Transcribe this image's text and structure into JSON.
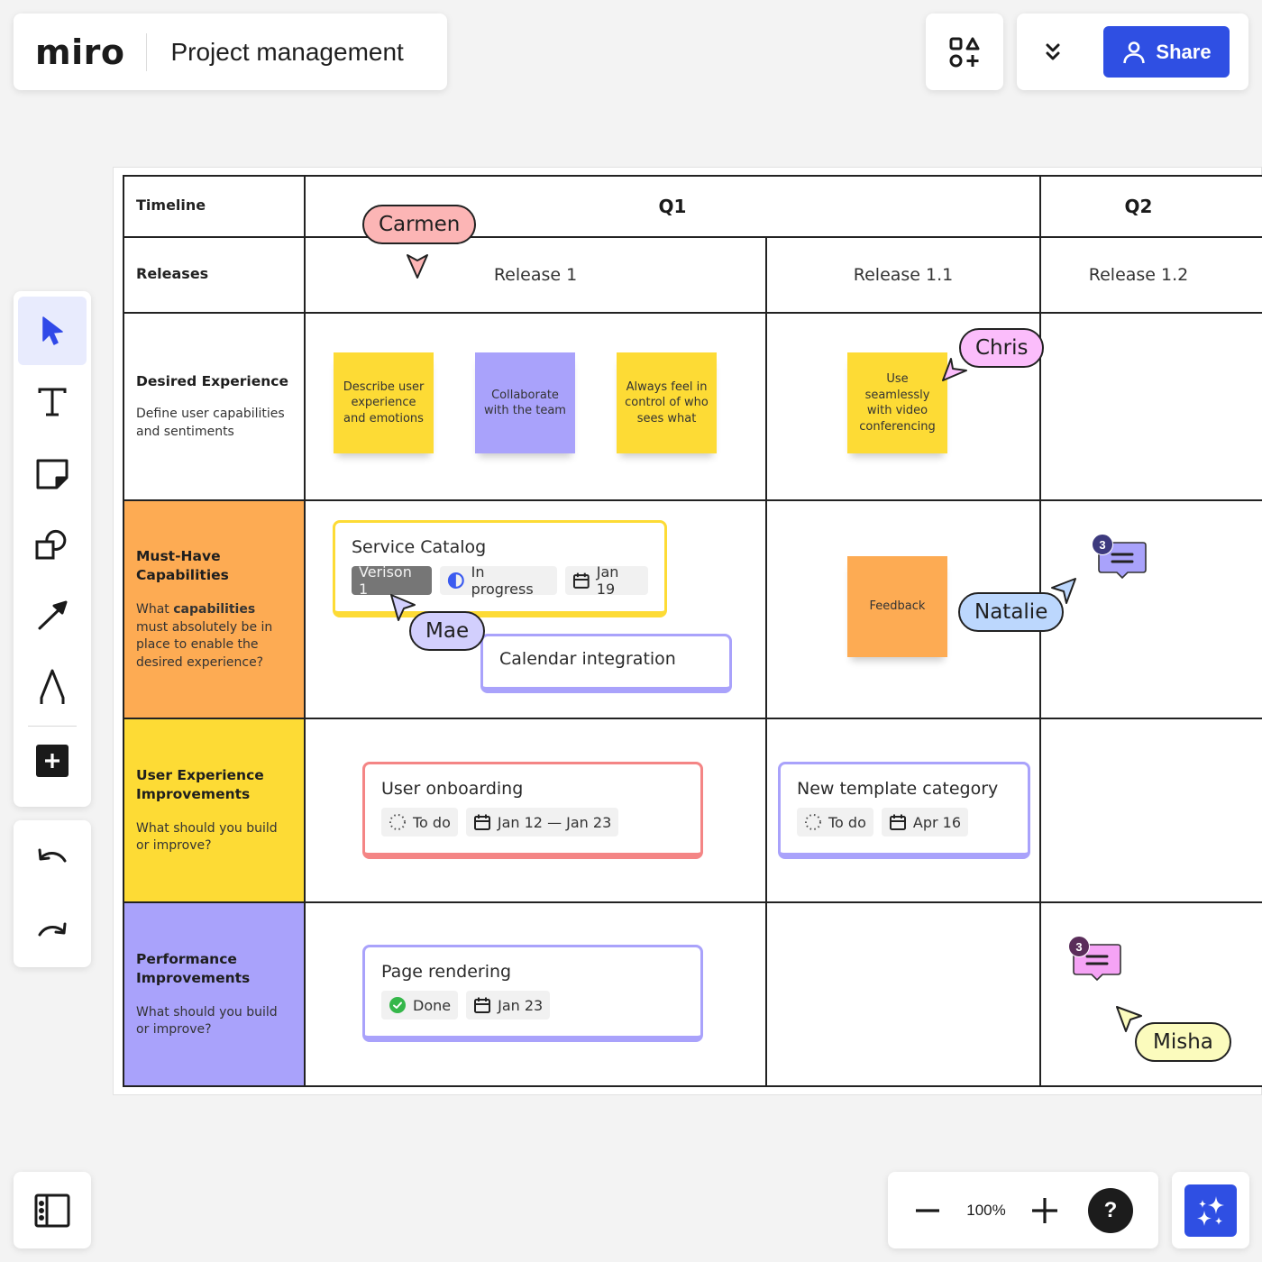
{
  "app": {
    "logo": "miro",
    "board_title": "Project management"
  },
  "topbar": {
    "templates_icon": "shapes-plus-icon",
    "collapse_icon": "double-chevron-down-icon",
    "share_label": "Share",
    "share_icon": "user-icon",
    "accent_color": "#2f4fe3"
  },
  "toolbar": {
    "tools": [
      {
        "name": "select",
        "icon": "cursor-icon",
        "active": true
      },
      {
        "name": "text",
        "icon": "text-icon"
      },
      {
        "name": "sticky-note",
        "icon": "sticky-note-icon"
      },
      {
        "name": "shapes",
        "icon": "shapes-icon"
      },
      {
        "name": "arrow",
        "icon": "arrow-icon"
      },
      {
        "name": "pen",
        "icon": "pen-icon"
      },
      {
        "name": "more",
        "icon": "plus-icon"
      }
    ],
    "undo_icon": "undo-icon",
    "redo_icon": "redo-icon"
  },
  "bottom": {
    "sidebar_icon": "sidebar-icon",
    "zoom_out_icon": "minus-icon",
    "zoom_level": "100%",
    "zoom_in_icon": "plus-icon",
    "help_label": "?",
    "ai_icon": "sparkles-icon"
  },
  "board": {
    "timeline_label": "Timeline",
    "releases_label": "Releases",
    "quarters": [
      "Q1",
      "Q2"
    ],
    "releases": [
      "Release 1",
      "Release 1.1",
      "Release 1.2"
    ],
    "rows": [
      {
        "title": "Desired Experience",
        "desc": "Define user capabilities and sentiments",
        "color": "#ffffff"
      },
      {
        "title": "Must-Have Capabilities",
        "desc_pre": "What ",
        "desc_bold": "capabilities",
        "desc_post": " must absolutely be in place to enable the desired experience?",
        "color": "#fdab53"
      },
      {
        "title": "User Experience Improvements",
        "desc": "What should you build or improve?",
        "color": "#fddb35"
      },
      {
        "title": "Performance Improvements",
        "desc": "What should you build or improve?",
        "color": "#a9a2fb"
      }
    ],
    "stickies": [
      {
        "text": "Describe user experience and emotions",
        "color": "yellow"
      },
      {
        "text": "Collaborate with the team",
        "color": "purple"
      },
      {
        "text": "Always feel in control of who sees what",
        "color": "yellow"
      },
      {
        "text": "Use seamlessly with video conferencing",
        "color": "yellow"
      },
      {
        "text": "Feedback",
        "color": "orange"
      }
    ],
    "cards": {
      "service_catalog": {
        "title": "Service Catalog",
        "version": "Verison 1",
        "status": "In progress",
        "date": "Jan 19"
      },
      "calendar": {
        "title": "Calendar integration"
      },
      "onboarding": {
        "title": "User onboarding",
        "status": "To do",
        "date": "Jan 12 — Jan 23"
      },
      "template": {
        "title": "New template category",
        "status": "To do",
        "date": "Apr 16"
      },
      "rendering": {
        "title": "Page rendering",
        "status": "Done",
        "date": "Jan 23"
      }
    },
    "cursors": [
      {
        "name": "Carmen",
        "color": "#fcb5b5"
      },
      {
        "name": "Chris",
        "color": "#fbbdfb"
      },
      {
        "name": "Mae",
        "color": "#d2cffd"
      },
      {
        "name": "Natalie",
        "color": "#bcd7fd"
      },
      {
        "name": "Misha",
        "color": "#fbfbbd"
      }
    ],
    "comments": [
      {
        "count": "3",
        "color": "#a9a2fb",
        "badge_color": "#3d3a7e"
      },
      {
        "count": "3",
        "color": "#f5a3f5",
        "badge_color": "#5a2d5a"
      }
    ]
  }
}
